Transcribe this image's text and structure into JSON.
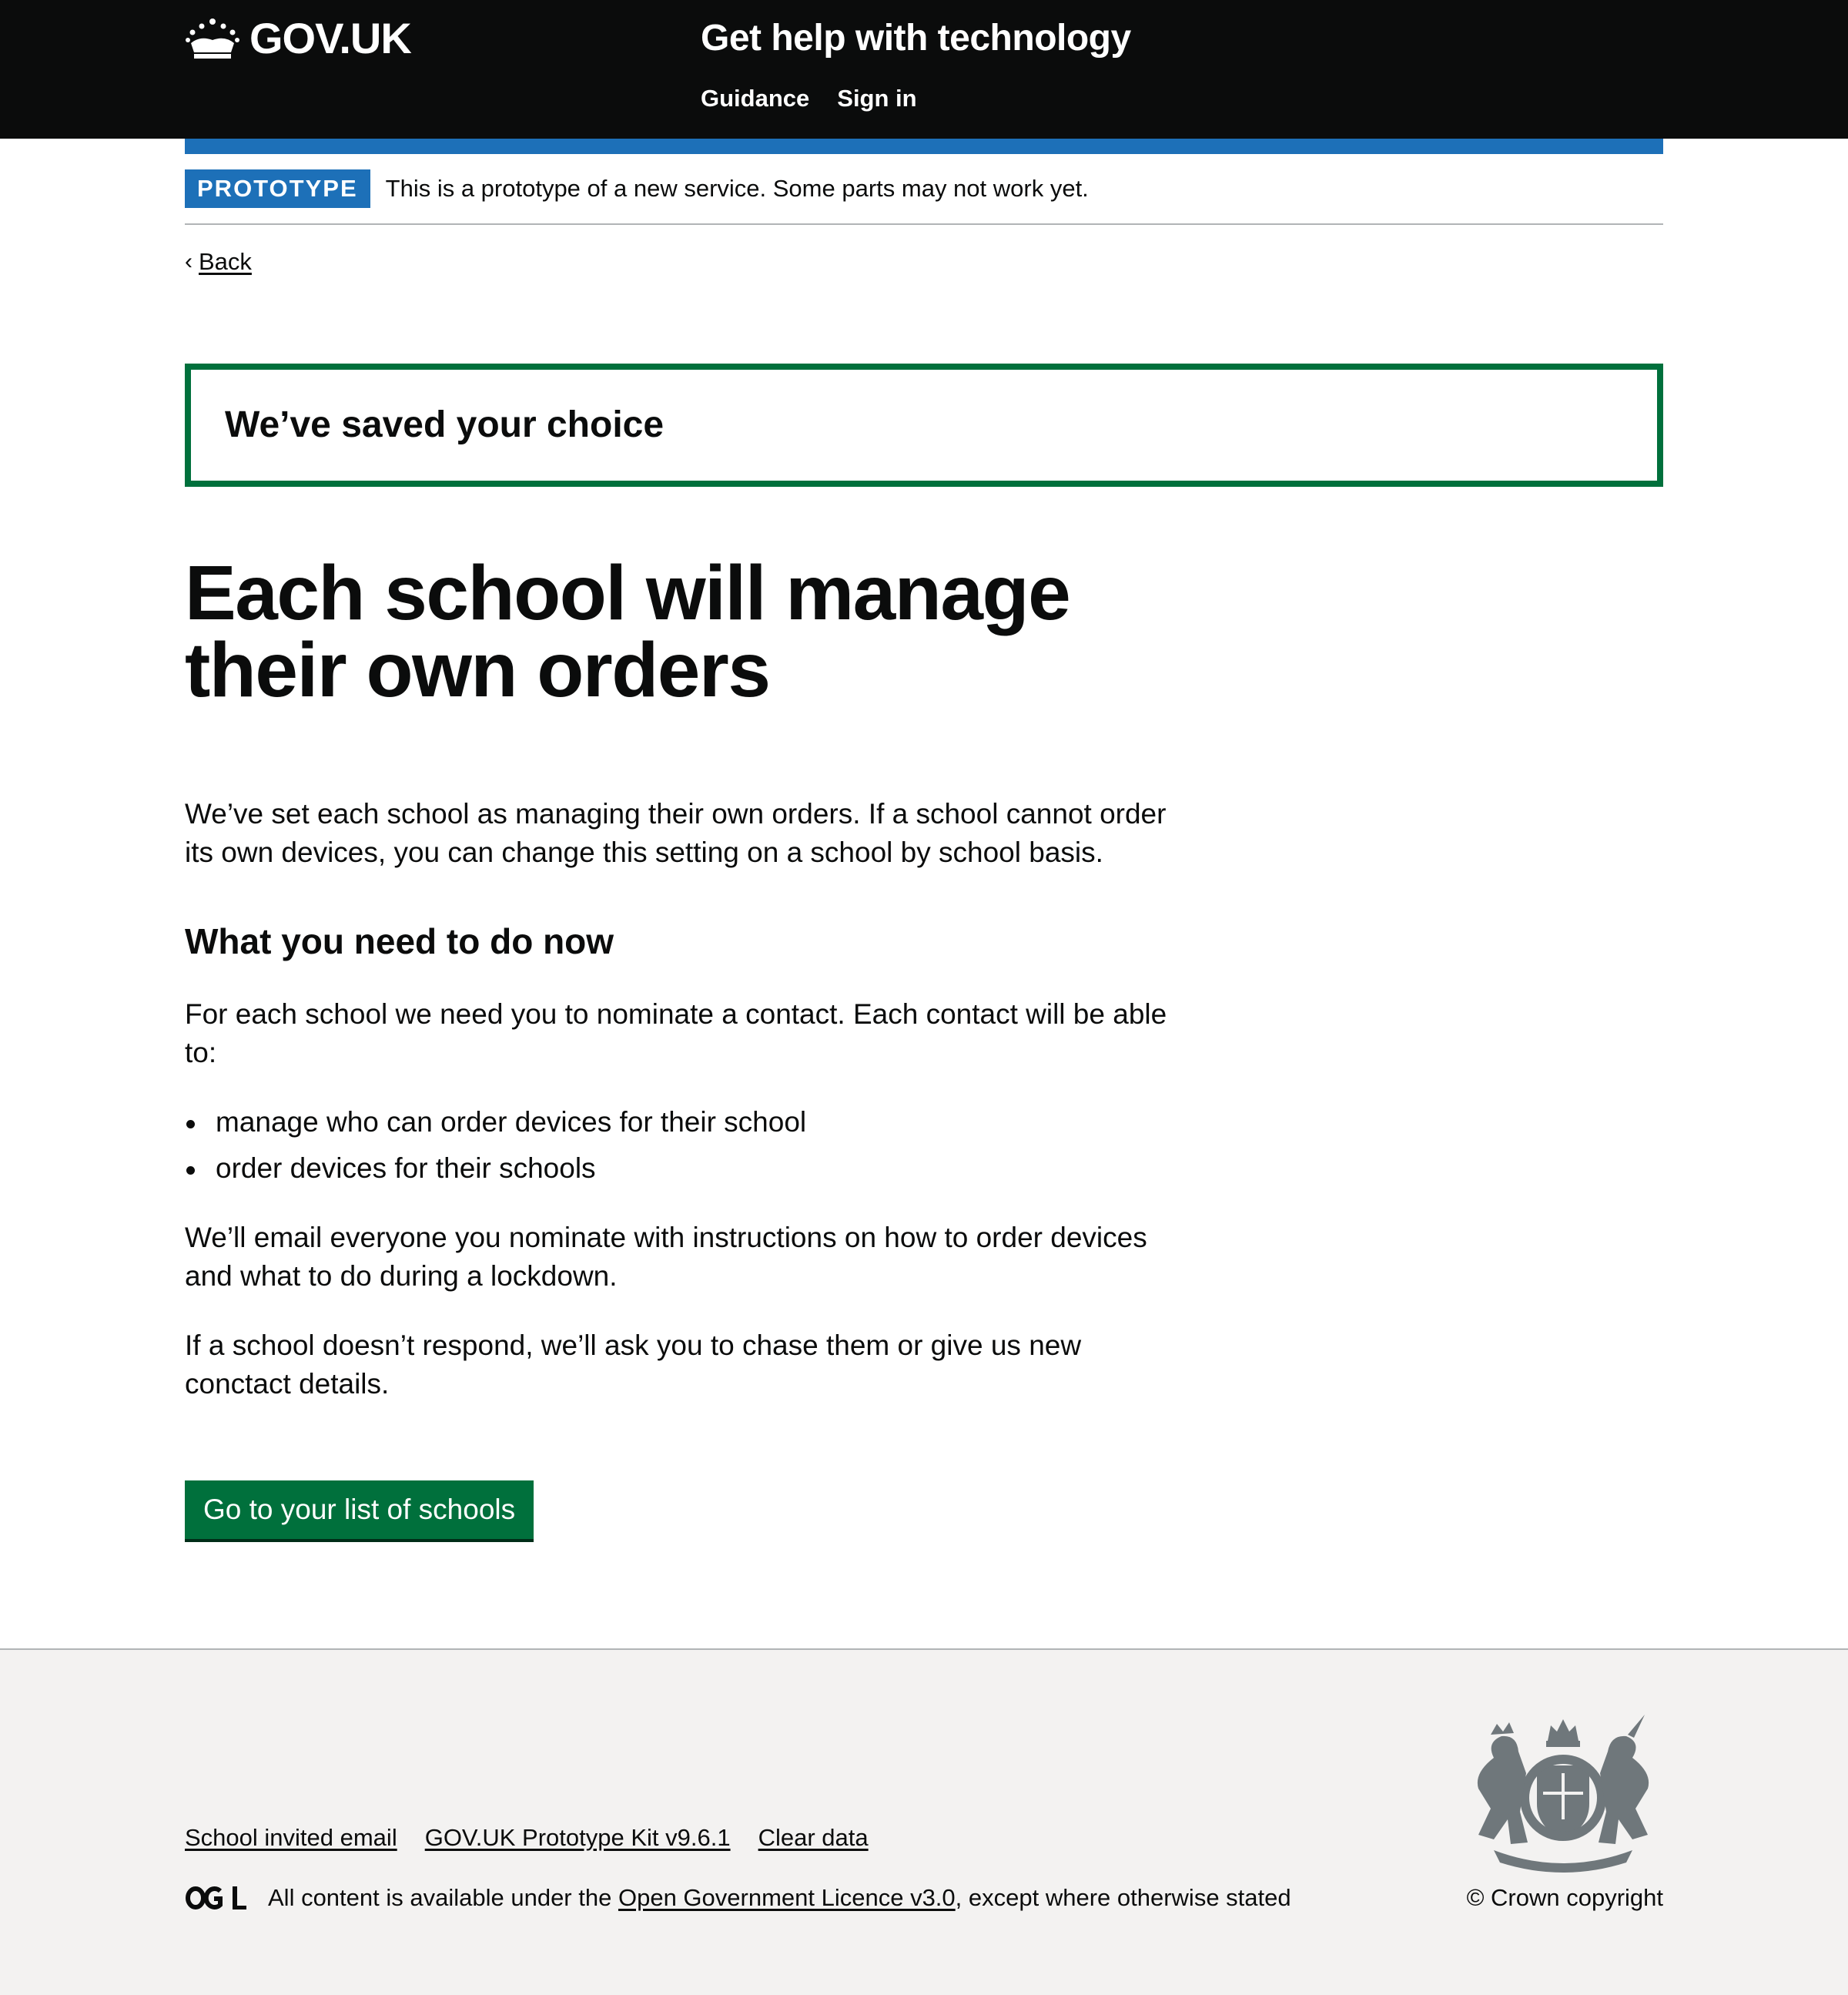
{
  "header": {
    "logo_text": "GOV.UK",
    "service_name": "Get help with technology",
    "nav": [
      {
        "label": "Guidance"
      },
      {
        "label": "Sign in"
      }
    ]
  },
  "phase_banner": {
    "tag": "PROTOTYPE",
    "text": "This is a prototype of a new service. Some parts may not work yet."
  },
  "back_link": {
    "label": "Back"
  },
  "notification": {
    "heading": "We’ve saved your choice"
  },
  "main": {
    "title_line1": "Each school will manage",
    "title_line2": "their own orders",
    "intro": "We’ve set each school as managing their own orders. If a school cannot order its own devices, you can change this setting on a school by school basis.",
    "subheading": "What you need to do now",
    "para_contact": "For each school we need you to nominate a contact. Each contact will be able to:",
    "list": [
      "manage who can order devices for their school",
      "order devices for their schools"
    ],
    "para_email": "We’ll email everyone you nominate with instructions on how to order devices and what to do during a lockdown.",
    "para_chase": "If a school doesn’t respond, we’ll ask you to chase them or give us new conctact details.",
    "button_label": "Go to your list of schools"
  },
  "footer": {
    "links": [
      {
        "label": "School invited email"
      },
      {
        "label": "GOV.UK Prototype Kit v9.6.1"
      },
      {
        "label": "Clear data"
      }
    ],
    "licence_prefix": "All content is available under the",
    "licence_link": "Open Government Licence v3.0",
    "licence_suffix": ", except where otherwise stated",
    "copyright": "© Crown copyright"
  },
  "colors": {
    "header_bg": "#0b0c0c",
    "brand_blue": "#1d70b8",
    "success_green": "#00703c",
    "footer_bg": "#f3f2f1"
  },
  "icons": [
    "crown-icon",
    "chevron-left-icon",
    "ogl-logo-icon",
    "royal-coat-of-arms-icon"
  ]
}
